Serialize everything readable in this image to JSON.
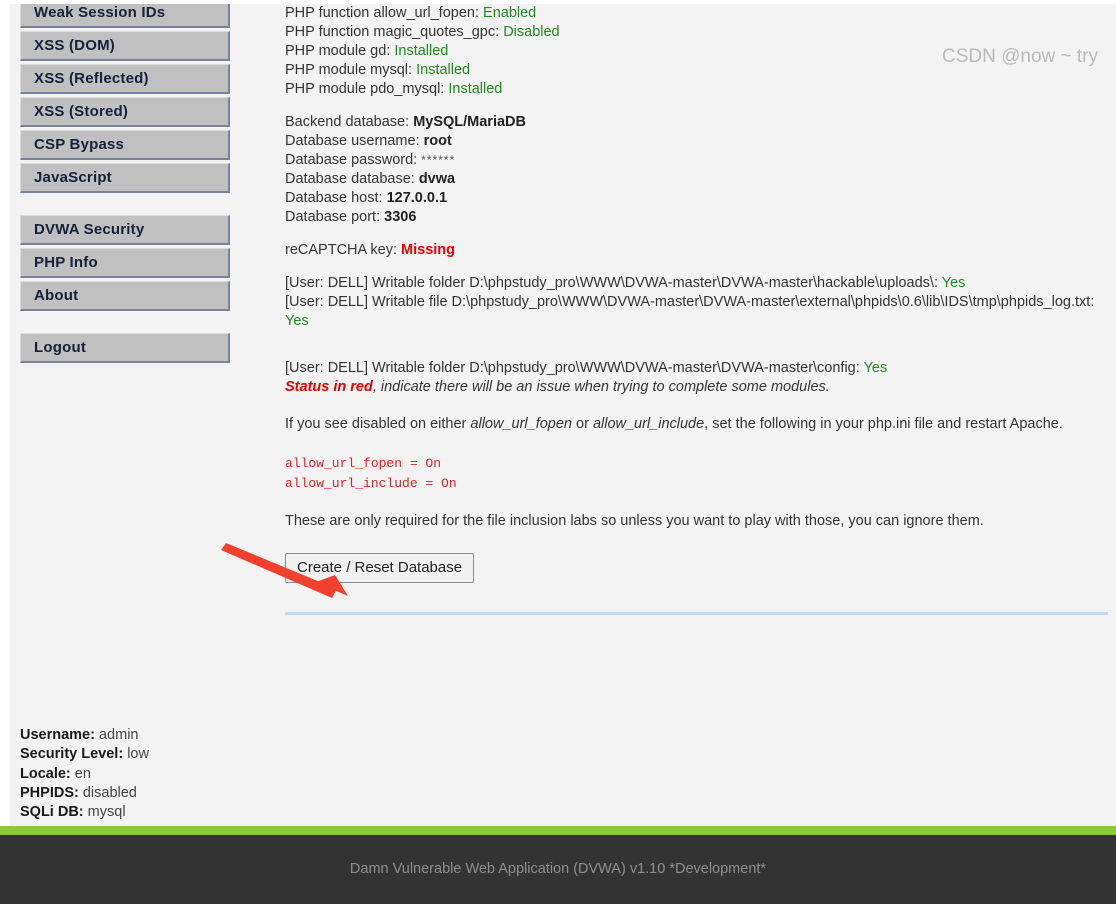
{
  "sidebar": {
    "groups": [
      {
        "items": [
          {
            "label": "Weak Session IDs"
          },
          {
            "label": "XSS (DOM)"
          },
          {
            "label": "XSS (Reflected)"
          },
          {
            "label": "XSS (Stored)"
          },
          {
            "label": "CSP Bypass"
          },
          {
            "label": "JavaScript"
          }
        ]
      },
      {
        "items": [
          {
            "label": "DVWA Security"
          },
          {
            "label": "PHP Info"
          },
          {
            "label": "About"
          }
        ]
      },
      {
        "items": [
          {
            "label": "Logout"
          }
        ]
      }
    ]
  },
  "main": {
    "php_status": [
      {
        "label": "PHP function allow_url_fopen:",
        "value": "Enabled",
        "state": "ok"
      },
      {
        "label": "PHP function magic_quotes_gpc:",
        "value": "Disabled",
        "state": "ok"
      },
      {
        "label": "PHP module gd:",
        "value": "Installed",
        "state": "ok"
      },
      {
        "label": "PHP module mysql:",
        "value": "Installed",
        "state": "ok"
      },
      {
        "label": "PHP module pdo_mysql:",
        "value": "Installed",
        "state": "ok"
      }
    ],
    "database": [
      {
        "label": "Backend database:",
        "value": "MySQL/MariaDB",
        "style": "bold"
      },
      {
        "label": "Database username:",
        "value": "root",
        "style": "bold"
      },
      {
        "label": "Database password:",
        "value": "******",
        "style": "password"
      },
      {
        "label": "Database database:",
        "value": "dvwa",
        "style": "bold"
      },
      {
        "label": "Database host:",
        "value": "127.0.0.1",
        "style": "bold"
      },
      {
        "label": "Database port:",
        "value": "3306",
        "style": "bold"
      }
    ],
    "recaptcha": {
      "label": "reCAPTCHA key:",
      "value": "Missing",
      "state": "bad"
    },
    "writable": [
      {
        "text": "[User: DELL] Writable folder D:\\phpstudy_pro\\WWW\\DVWA-master\\DVWA-master\\hackable\\uploads\\:",
        "value": "Yes",
        "state": "ok"
      },
      {
        "text": "[User: DELL] Writable file D:\\phpstudy_pro\\WWW\\DVWA-master\\DVWA-master\\external\\phpids\\0.6\\lib\\IDS\\tmp\\phpids_log.txt:",
        "value": "Yes",
        "state": "ok"
      }
    ],
    "writable_config": {
      "text": "[User: DELL] Writable folder D:\\phpstudy_pro\\WWW\\DVWA-master\\DVWA-master\\config:",
      "value": "Yes",
      "state": "ok"
    },
    "status_note": {
      "red": "Status in red",
      "rest": ", indicate there will be an issue when trying to complete some modules."
    },
    "disabled_note": {
      "part1": "If you see disabled on either ",
      "param1": "allow_url_fopen",
      "part2": " or ",
      "param2": "allow_url_include",
      "part3": ", set the following in your php.ini file and restart Apache."
    },
    "ini_lines": [
      "allow_url_fopen = On",
      "allow_url_include = On"
    ],
    "file_inclusion_note": "These are only required for the file inclusion labs so unless you want to play with those, you can ignore them.",
    "reset_button": "Create / Reset Database"
  },
  "login_info": [
    {
      "label": "Username:",
      "value": "admin"
    },
    {
      "label": "Security Level:",
      "value": "low"
    },
    {
      "label": "Locale:",
      "value": "en"
    },
    {
      "label": "PHPIDS:",
      "value": "disabled"
    },
    {
      "label": "SQLi DB:",
      "value": "mysql"
    }
  ],
  "footer": {
    "text": "Damn Vulnerable Web Application (DVWA) v1.10 *Development*",
    "watermark": "CSDN @now ~ try"
  },
  "colors": {
    "accent_green": "#8dc63f",
    "footer_bg": "#333333",
    "status_ok": "#1f8a1f",
    "status_bad": "#ee0000",
    "arrow": "#f2402f",
    "nav_bg": "#c0c0c0"
  }
}
